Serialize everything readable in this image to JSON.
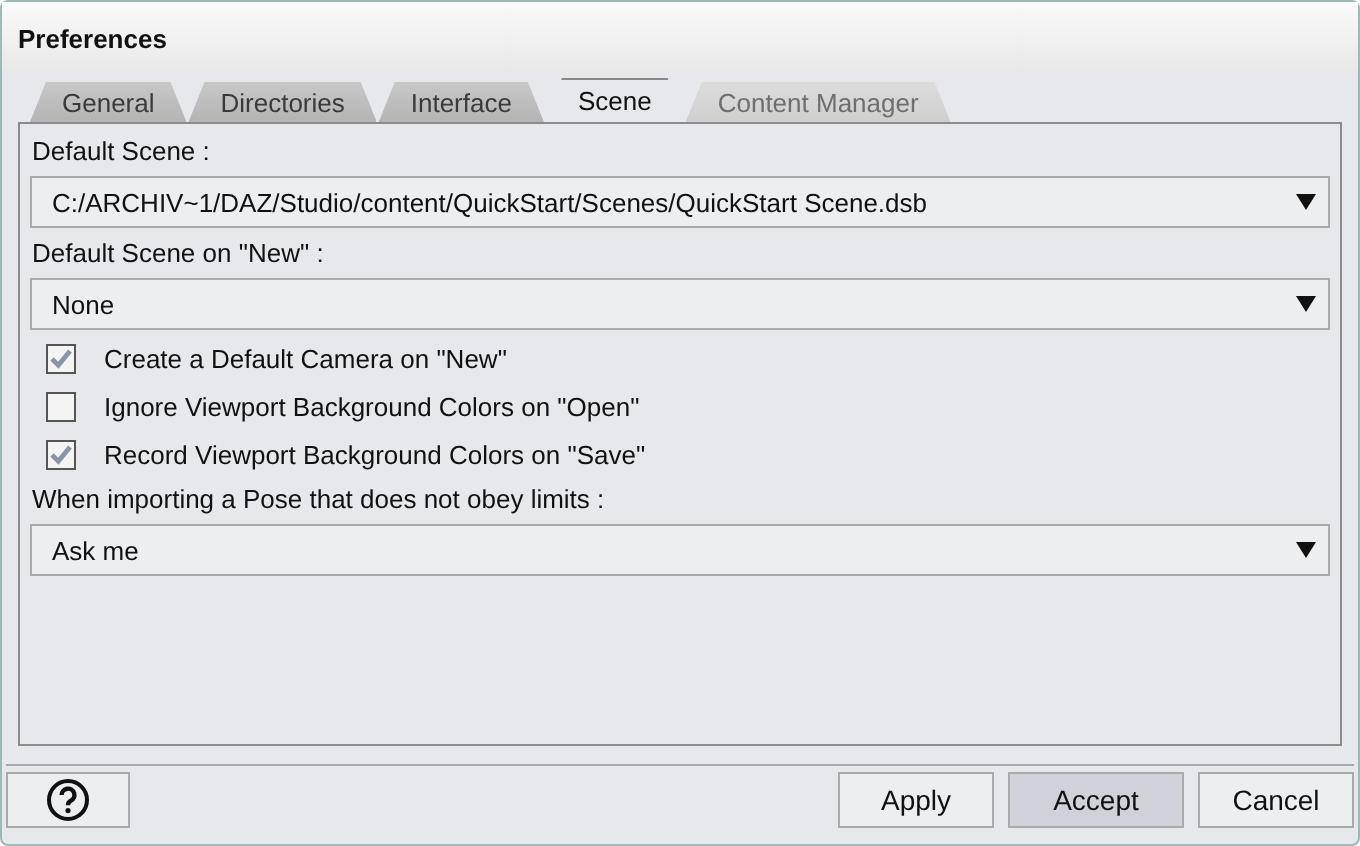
{
  "window": {
    "title": "Preferences"
  },
  "tabs": [
    {
      "label": "General",
      "selected": false,
      "disabled": false
    },
    {
      "label": "Directories",
      "selected": false,
      "disabled": false
    },
    {
      "label": "Interface",
      "selected": false,
      "disabled": false
    },
    {
      "label": "Scene",
      "selected": true,
      "disabled": false
    },
    {
      "label": "Content Manager",
      "selected": false,
      "disabled": true
    }
  ],
  "settings": [
    {
      "kind": "label",
      "text": "Default Scene :"
    },
    {
      "kind": "dropdown",
      "value": "C:/ARCHIV~1/DAZ/Studio/content/QuickStart/Scenes/QuickStart Scene.dsb"
    },
    {
      "kind": "label",
      "text": "Default Scene on \"New\" :"
    },
    {
      "kind": "dropdown",
      "value": "None"
    },
    {
      "kind": "checkbox",
      "text": "Create a Default Camera on \"New\"",
      "checked": true
    },
    {
      "kind": "checkbox",
      "text": "Ignore Viewport Background Colors on \"Open\"",
      "checked": false
    },
    {
      "kind": "checkbox",
      "text": "Record Viewport Background Colors on \"Save\"",
      "checked": true
    },
    {
      "kind": "label",
      "text": "When importing a Pose that does not obey limits :"
    },
    {
      "kind": "dropdown",
      "value": "Ask me"
    }
  ],
  "buttons": [
    {
      "label": "Apply",
      "default": false
    },
    {
      "label": "Accept",
      "default": true
    },
    {
      "label": "Cancel",
      "default": false
    }
  ]
}
